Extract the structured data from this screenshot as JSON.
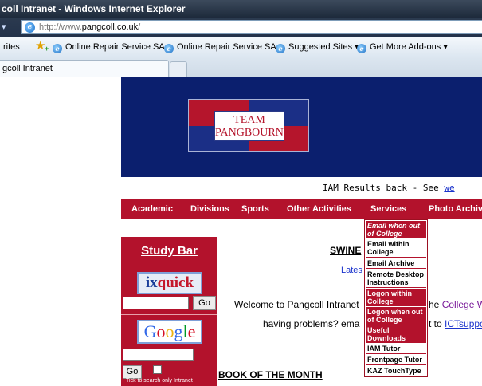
{
  "browser": {
    "window_title": "coll Intranet - Windows Internet Explorer",
    "address_prefix": "http://www.",
    "address_host": "pangcoll.co.uk",
    "address_suffix": "/",
    "favorites_label": "rites",
    "favorites": [
      {
        "label": "Online Repair Service SA..."
      },
      {
        "label": "Online Repair Service SA..."
      },
      {
        "label": "Suggested Sites ▾"
      },
      {
        "label": "Get More Add-ons ▾"
      }
    ],
    "active_tab": "gcoll Intranet"
  },
  "banner": {
    "logo_line1": "TEAM",
    "logo_line2": "PANGBOURNE"
  },
  "announcement": {
    "text": "IAM Results back - See ",
    "link": "we"
  },
  "menu": {
    "items": [
      "Academic",
      "Divisions",
      "Sports",
      "Other Activities",
      "Services",
      "Photo Archive"
    ]
  },
  "services_dropdown": {
    "items": [
      {
        "label": "Email when out\nof College"
      },
      {
        "label": "Email within\nCollege"
      },
      {
        "label": "Email Archive"
      },
      {
        "label": "Remote Desktop\nInstructions"
      },
      {
        "label": "Logon within\nCollege"
      },
      {
        "label": "Logon when out\nof College"
      },
      {
        "label": "Useful\nDownloads"
      },
      {
        "label": "IAM Tutor"
      },
      {
        "label": "Frontpage Tutor"
      },
      {
        "label": "KAZ TouchType"
      }
    ]
  },
  "study_bar": {
    "title": "Study Bar",
    "ixquick_ix": "ix",
    "ixquick_quick": "quick",
    "ixquick_go": "Go",
    "google_go": "Go",
    "intranet_only_label": "Tick to search only Intranet"
  },
  "content": {
    "swine_heading": "SWINE",
    "latest_link": "Lates",
    "welcome_line": "Welcome to Pangcoll Intranet",
    "welcome_tail_prefix": "he ",
    "welcome_tail_link": "College W",
    "problems_line": "having problems? ema",
    "problems_tail_prefix": "t to ",
    "problems_tail_link": "ICTsuppo",
    "book_heading": "BOOK OF THE MONTH"
  },
  "colors": {
    "brand_red": "#b3122c",
    "banner_navy": "#0b1f6e",
    "link_blue": "#1a33cc"
  }
}
